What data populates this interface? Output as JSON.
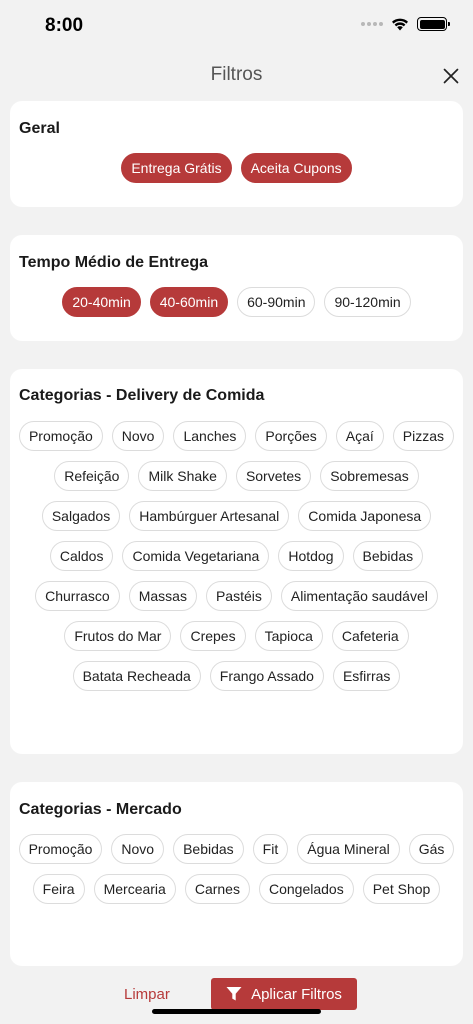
{
  "status_bar": {
    "time": "8:00"
  },
  "header": {
    "title": "Filtros"
  },
  "sections": {
    "geral": {
      "title": "Geral",
      "chips": [
        {
          "label": "Entrega Grátis",
          "selected": true
        },
        {
          "label": "Aceita Cupons",
          "selected": true
        }
      ]
    },
    "tempo": {
      "title": "Tempo Médio de Entrega",
      "chips": [
        {
          "label": "20-40min",
          "selected": true
        },
        {
          "label": "40-60min",
          "selected": true
        },
        {
          "label": "60-90min",
          "selected": false
        },
        {
          "label": "90-120min",
          "selected": false
        }
      ]
    },
    "comida": {
      "title": "Categorias - Delivery de Comida",
      "chips": [
        {
          "label": "Promoção",
          "selected": false
        },
        {
          "label": "Novo",
          "selected": false
        },
        {
          "label": "Lanches",
          "selected": false
        },
        {
          "label": "Porções",
          "selected": false
        },
        {
          "label": "Açaí",
          "selected": false
        },
        {
          "label": "Pizzas",
          "selected": false
        },
        {
          "label": "Refeição",
          "selected": false
        },
        {
          "label": "Milk Shake",
          "selected": false
        },
        {
          "label": "Sorvetes",
          "selected": false
        },
        {
          "label": "Sobremesas",
          "selected": false
        },
        {
          "label": "Salgados",
          "selected": false
        },
        {
          "label": "Hambúrguer Artesanal",
          "selected": false
        },
        {
          "label": "Comida Japonesa",
          "selected": false
        },
        {
          "label": "Caldos",
          "selected": false
        },
        {
          "label": "Comida Vegetariana",
          "selected": false
        },
        {
          "label": "Hotdog",
          "selected": false
        },
        {
          "label": "Bebidas",
          "selected": false
        },
        {
          "label": "Churrasco",
          "selected": false
        },
        {
          "label": "Massas",
          "selected": false
        },
        {
          "label": "Pastéis",
          "selected": false
        },
        {
          "label": "Alimentação saudável",
          "selected": false
        },
        {
          "label": "Frutos do Mar",
          "selected": false
        },
        {
          "label": "Crepes",
          "selected": false
        },
        {
          "label": "Tapioca",
          "selected": false
        },
        {
          "label": "Cafeteria",
          "selected": false
        },
        {
          "label": "Batata Recheada",
          "selected": false
        },
        {
          "label": "Frango Assado",
          "selected": false
        },
        {
          "label": "Esfirras",
          "selected": false
        }
      ]
    },
    "mercado": {
      "title": "Categorias - Mercado",
      "chips": [
        {
          "label": "Promoção",
          "selected": false
        },
        {
          "label": "Novo",
          "selected": false
        },
        {
          "label": "Bebidas",
          "selected": false
        },
        {
          "label": "Fit",
          "selected": false
        },
        {
          "label": "Água Mineral",
          "selected": false
        },
        {
          "label": "Gás",
          "selected": false
        },
        {
          "label": "Feira",
          "selected": false
        },
        {
          "label": "Mercearia",
          "selected": false
        },
        {
          "label": "Carnes",
          "selected": false
        },
        {
          "label": "Congelados",
          "selected": false
        },
        {
          "label": "Pet Shop",
          "selected": false
        }
      ]
    }
  },
  "footer": {
    "clear_label": "Limpar",
    "apply_label": "Aplicar Filtros",
    "apply_icon": "filter-icon"
  },
  "colors": {
    "accent": "#b63a3a",
    "background": "#f2f2f2",
    "card": "#ffffff",
    "chip_border": "#dcdcdc"
  }
}
